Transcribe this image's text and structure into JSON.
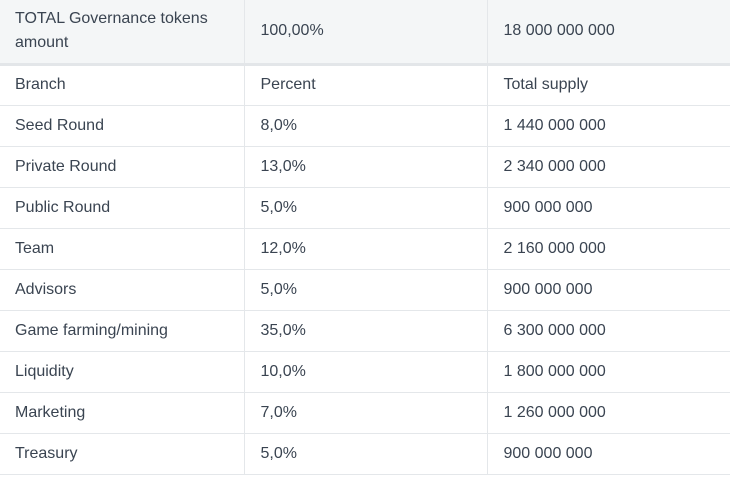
{
  "table": {
    "header": [
      "TOTAL Governance tokens amount",
      "100,00%",
      "18 000 000 000"
    ],
    "rows": [
      [
        "Branch",
        "Percent",
        "Total supply"
      ],
      [
        "Seed Round",
        "8,0%",
        "1 440 000 000"
      ],
      [
        "Private Round",
        "13,0%",
        "2 340 000 000"
      ],
      [
        "Public Round",
        "5,0%",
        "900 000 000"
      ],
      [
        "Team",
        "12,0%",
        "2 160 000 000"
      ],
      [
        "Advisors",
        "5,0%",
        "900 000 000"
      ],
      [
        "Game farming/mining",
        "35,0%",
        "6 300 000 000"
      ],
      [
        "Liquidity",
        "10,0%",
        "1 800 000 000"
      ],
      [
        "Marketing",
        "7,0%",
        "1 260 000 000"
      ],
      [
        "Treasury",
        "5,0%",
        "900 000 000"
      ]
    ]
  }
}
